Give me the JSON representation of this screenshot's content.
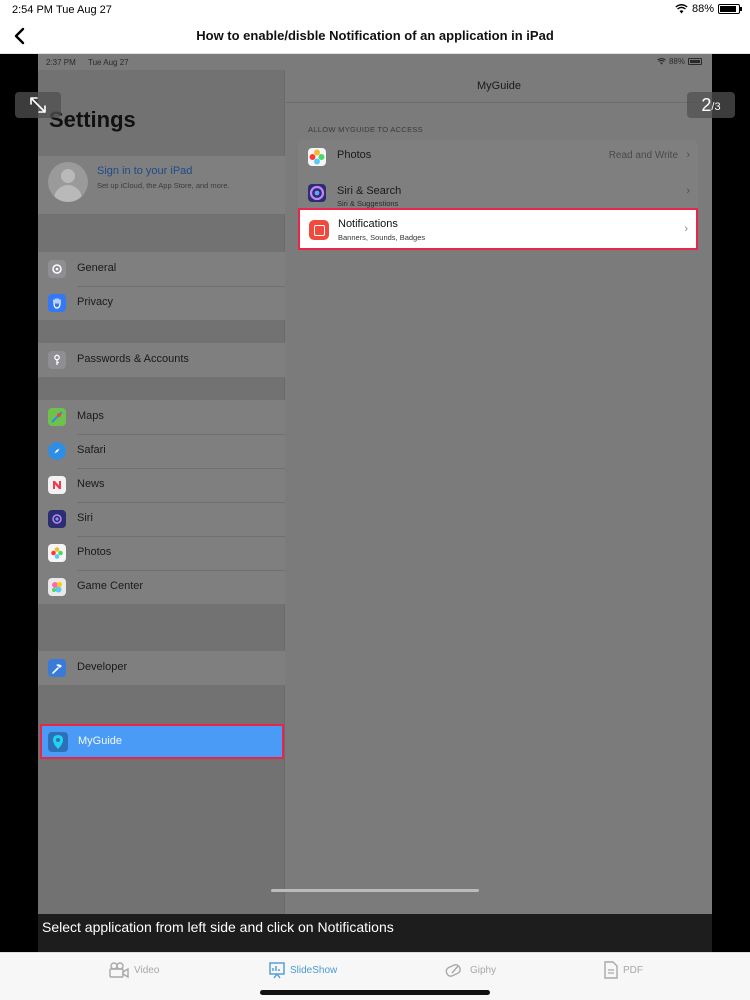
{
  "status_bar": {
    "time": "2:54 PM",
    "date": "Tue Aug 27",
    "battery": "88%"
  },
  "header": {
    "title": "How to enable/disble Notification of an application in iPad"
  },
  "slide": {
    "status": {
      "time": "2:37 PM",
      "date": "Tue Aug 27",
      "battery": "88%"
    },
    "settings_title": "Settings",
    "profile": {
      "title": "Sign in to your iPad",
      "subtitle": "Set up iCloud, the App Store, and more."
    },
    "groups": [
      [
        {
          "label": "General",
          "icon": "gear-icon",
          "color": "#8e8e93"
        },
        {
          "label": "Privacy",
          "icon": "hand-icon",
          "color": "#3478f6"
        }
      ],
      [
        {
          "label": "Passwords & Accounts",
          "icon": "key-icon",
          "color": "#8e8e93"
        }
      ],
      [
        {
          "label": "Maps",
          "icon": "maps-icon",
          "color": "#6cc24a"
        },
        {
          "label": "Safari",
          "icon": "compass-icon",
          "color": "#2f8de4"
        },
        {
          "label": "News",
          "icon": "news-icon",
          "color": "#f2f2f2"
        },
        {
          "label": "Siri",
          "icon": "siri-icon",
          "color": "#2b2d6e"
        },
        {
          "label": "Photos",
          "icon": "photos-icon",
          "color": "#f5f5f5"
        },
        {
          "label": "Game Center",
          "icon": "game-center-icon",
          "color": "#e9e9e9"
        }
      ],
      [
        {
          "label": "Developer",
          "icon": "hammer-icon",
          "color": "#3b7bd8"
        }
      ]
    ],
    "selected_app": "MyGuide",
    "right": {
      "nav_title": "MyGuide",
      "section_header": "ALLOW MYGUIDE TO ACCESS",
      "rows": [
        {
          "label": "Photos",
          "value": "Read and Write"
        },
        {
          "label": "Siri & Search",
          "subtitle": "Siri & Suggestions"
        }
      ],
      "notifications": {
        "label": "Notifications",
        "subtitle": "Banners, Sounds, Badges"
      }
    },
    "page_counter": {
      "current": "2",
      "total": "/3"
    }
  },
  "caption": "Select application from left side and click on Notifications",
  "tabs": [
    {
      "label": "Video",
      "icon": "video-icon",
      "active": false
    },
    {
      "label": "SlideShow",
      "icon": "slideshow-icon",
      "active": true
    },
    {
      "label": "Giphy",
      "icon": "giphy-icon",
      "active": false
    },
    {
      "label": "PDF",
      "icon": "pdf-icon",
      "active": false
    }
  ],
  "colors": {
    "accent": "#4a9bd6",
    "highlight": "#e8264b",
    "selected_row": "#4a9bf5"
  }
}
